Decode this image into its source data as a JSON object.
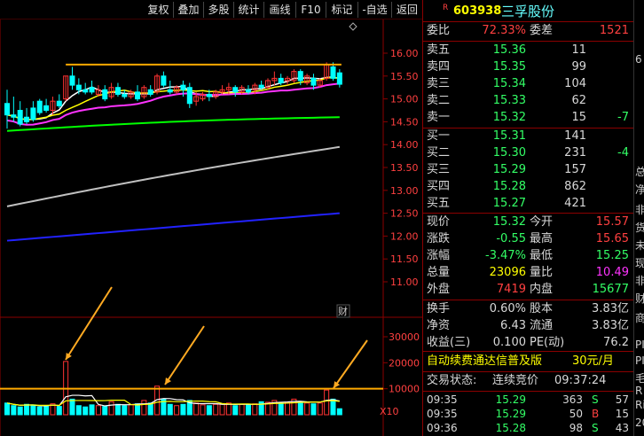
{
  "toolbar": {
    "buttons": [
      "复权",
      "叠加",
      "多股",
      "统计",
      "画线",
      "F10",
      "标记",
      "-自选",
      "返回"
    ]
  },
  "chart": {
    "price_axis": [
      "16.00",
      "15.50",
      "15.00",
      "14.50",
      "14.00",
      "13.50",
      "13.00",
      "12.50",
      "12.00",
      "11.50",
      "11.00"
    ],
    "volume_axis": [
      "30000",
      "20000",
      "10000"
    ],
    "volume_unit": "X10",
    "fin_tag": "财",
    "colors": {
      "up": "#ff3333",
      "down": "#00ffff",
      "ma5": "#ffffff",
      "ma10": "#ffff00",
      "ma20": "#ff33ff",
      "ma60": "#00ff00",
      "ma120": "#c0c0c0",
      "ma250": "#2222ff",
      "resistance": "#ffaa00",
      "arrow": "#ffaa22"
    },
    "candles": [
      [
        14.9,
        15.2,
        14.65,
        14.35
      ],
      [
        14.65,
        15.05,
        14.6,
        14.5
      ],
      [
        14.75,
        14.95,
        14.45,
        14.4
      ],
      [
        14.6,
        14.8,
        14.5,
        14.45
      ],
      [
        14.8,
        14.95,
        14.55,
        14.5
      ],
      [
        14.95,
        15.0,
        14.7,
        14.65
      ],
      [
        14.85,
        15.0,
        14.75,
        14.7
      ],
      [
        14.75,
        15.05,
        14.95,
        14.65
      ],
      [
        14.95,
        15.1,
        14.85,
        14.8
      ],
      [
        15.0,
        15.5,
        15.5,
        14.95
      ],
      [
        15.5,
        15.7,
        15.3,
        15.2
      ],
      [
        15.3,
        15.45,
        15.2,
        15.1
      ],
      [
        15.2,
        15.35,
        15.15,
        15.1
      ],
      [
        15.25,
        15.4,
        15.15,
        15.1
      ],
      [
        15.1,
        15.3,
        15.2,
        15.05
      ],
      [
        15.2,
        15.3,
        15.0,
        14.95
      ],
      [
        15.05,
        15.35,
        15.25,
        15.0
      ],
      [
        15.25,
        15.35,
        15.1,
        15.05
      ],
      [
        15.1,
        15.2,
        15.05,
        15.0
      ],
      [
        15.05,
        15.2,
        15.15,
        15.0
      ],
      [
        15.15,
        15.3,
        15.0,
        14.95
      ],
      [
        15.05,
        15.3,
        15.25,
        15.0
      ],
      [
        15.2,
        15.3,
        15.1,
        15.05
      ],
      [
        15.15,
        15.55,
        15.5,
        15.1
      ],
      [
        15.5,
        15.6,
        15.3,
        15.25
      ],
      [
        15.2,
        15.4,
        15.15,
        15.1
      ],
      [
        15.15,
        15.3,
        15.25,
        15.1
      ],
      [
        15.3,
        15.4,
        15.2,
        15.05
      ],
      [
        15.25,
        15.35,
        14.9,
        14.8
      ],
      [
        14.95,
        15.15,
        15.05,
        14.85
      ],
      [
        15.0,
        15.15,
        15.1,
        14.95
      ],
      [
        15.1,
        15.2,
        15.05,
        14.95
      ],
      [
        15.05,
        15.2,
        15.15,
        15.0
      ],
      [
        15.15,
        15.3,
        15.2,
        15.1
      ],
      [
        15.2,
        15.35,
        15.25,
        15.1
      ],
      [
        15.25,
        15.3,
        15.15,
        15.05
      ],
      [
        15.15,
        15.3,
        15.25,
        15.1
      ],
      [
        15.2,
        15.3,
        15.15,
        15.1
      ],
      [
        15.2,
        15.35,
        15.3,
        15.1
      ],
      [
        15.3,
        15.4,
        15.25,
        15.2
      ],
      [
        15.25,
        15.45,
        15.4,
        15.2
      ],
      [
        15.4,
        15.6,
        15.45,
        15.3
      ],
      [
        15.45,
        15.55,
        15.35,
        15.3
      ],
      [
        15.4,
        15.5,
        15.45,
        15.3
      ],
      [
        15.4,
        15.65,
        15.6,
        15.35
      ],
      [
        15.6,
        15.65,
        15.4,
        15.3
      ],
      [
        15.35,
        15.55,
        15.5,
        15.3
      ],
      [
        15.45,
        15.55,
        15.3,
        15.2
      ],
      [
        15.3,
        15.45,
        15.4,
        15.25
      ],
      [
        15.45,
        15.8,
        15.75,
        15.4
      ],
      [
        15.7,
        15.8,
        15.45,
        15.4
      ],
      [
        15.57,
        15.65,
        15.32,
        15.25
      ]
    ],
    "volumes": [
      4500,
      3500,
      3000,
      4000,
      3800,
      3000,
      3500,
      4200,
      3200,
      20500,
      6000,
      3500,
      3000,
      3800,
      3500,
      3200,
      5000,
      4000,
      3500,
      3800,
      4200,
      5500,
      4500,
      11000,
      6000,
      4000,
      3500,
      4000,
      5500,
      4500,
      3800,
      3500,
      4000,
      4200,
      4500,
      3500,
      4000,
      3800,
      4200,
      5000,
      4800,
      5500,
      4500,
      4800,
      6000,
      5000,
      4500,
      4200,
      4500,
      9500,
      6000,
      2309
    ],
    "ma_values": {
      "ma60_start": 14.3,
      "ma60_end": 14.6,
      "ma120_start": 12.65,
      "ma120_end": 13.95,
      "ma250_start": 11.9,
      "ma250_end": 12.5
    },
    "resistance_price": 15.75,
    "volume_line": 10000
  },
  "quote": {
    "code_prefix": "R",
    "code": "603938",
    "name": "三孚股份",
    "weibi_label": "委比",
    "weibi_value": "72.33%",
    "weicha_label": "委差",
    "weicha_value": "1521",
    "asks": [
      {
        "label": "卖五",
        "price": "15.36",
        "vol": "11",
        "chg": ""
      },
      {
        "label": "卖四",
        "price": "15.35",
        "vol": "99",
        "chg": ""
      },
      {
        "label": "卖三",
        "price": "15.34",
        "vol": "104",
        "chg": ""
      },
      {
        "label": "卖二",
        "price": "15.33",
        "vol": "62",
        "chg": ""
      },
      {
        "label": "卖一",
        "price": "15.32",
        "vol": "15",
        "chg": "-7"
      }
    ],
    "bids": [
      {
        "label": "买一",
        "price": "15.31",
        "vol": "141",
        "chg": ""
      },
      {
        "label": "买二",
        "price": "15.30",
        "vol": "231",
        "chg": "-4"
      },
      {
        "label": "买三",
        "price": "15.29",
        "vol": "157",
        "chg": ""
      },
      {
        "label": "买四",
        "price": "15.28",
        "vol": "862",
        "chg": ""
      },
      {
        "label": "买五",
        "price": "15.27",
        "vol": "421",
        "chg": ""
      }
    ],
    "stats": [
      {
        "l1": "现价",
        "v1": "15.32",
        "c1": "green",
        "l2": "今开",
        "v2": "15.57",
        "c2": "red"
      },
      {
        "l1": "涨跌",
        "v1": "-0.55",
        "c1": "green",
        "l2": "最高",
        "v2": "15.65",
        "c2": "red"
      },
      {
        "l1": "涨幅",
        "v1": "-3.47%",
        "c1": "green",
        "l2": "最低",
        "v2": "15.25",
        "c2": "green"
      },
      {
        "l1": "总量",
        "v1": "23096",
        "c1": "yellow",
        "l2": "量比",
        "v2": "10.49",
        "c2": "magenta"
      },
      {
        "l1": "外盘",
        "v1": "7419",
        "c1": "red",
        "l2": "内盘",
        "v2": "15677",
        "c2": "green"
      }
    ],
    "finance": [
      {
        "l1": "换手",
        "v1": "0.60%",
        "l2": "股本",
        "v2": "3.83亿"
      },
      {
        "l1": "净资",
        "v1": "6.43",
        "l2": "流通",
        "v2": "3.83亿"
      },
      {
        "l1": "收益(三)",
        "v1": "0.100",
        "l2": "PE(动)",
        "v2": "76.2"
      }
    ],
    "ad_text": "自动续费通达信普及版",
    "ad_price": "30元/月",
    "status_label": "交易状态:",
    "status_value": "连续竞价",
    "status_time": "09:37:24",
    "ticks": [
      {
        "time": "09:35",
        "price": "15.29",
        "vol": "363",
        "side": "S",
        "num": "57"
      },
      {
        "time": "09:35",
        "price": "15.29",
        "vol": "50",
        "side": "B",
        "num": "15"
      },
      {
        "time": "09:36",
        "price": "15.28",
        "vol": "98",
        "side": "S",
        "num": "43"
      }
    ]
  },
  "edge": {
    "chars": [
      "6",
      "总",
      "净",
      "非",
      "货",
      "未",
      "现",
      "非",
      "财",
      "商",
      "PI",
      "PI",
      "毛",
      "R",
      "Ri",
      "20"
    ]
  }
}
